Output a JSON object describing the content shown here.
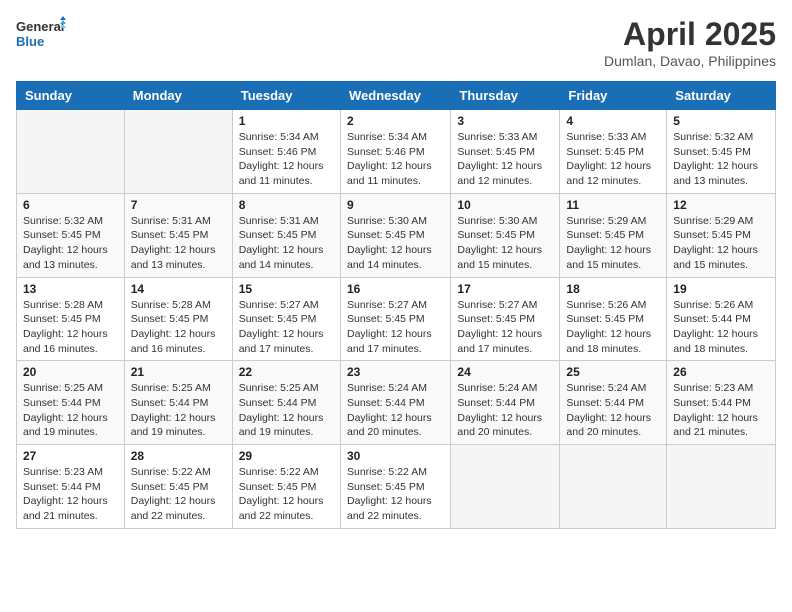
{
  "header": {
    "logo_line1": "General",
    "logo_line2": "Blue",
    "main_title": "April 2025",
    "subtitle": "Dumlan, Davao, Philippines"
  },
  "calendar": {
    "days_of_week": [
      "Sunday",
      "Monday",
      "Tuesday",
      "Wednesday",
      "Thursday",
      "Friday",
      "Saturday"
    ],
    "weeks": [
      [
        {
          "day": "",
          "sunrise": "",
          "sunset": "",
          "daylight": ""
        },
        {
          "day": "",
          "sunrise": "",
          "sunset": "",
          "daylight": ""
        },
        {
          "day": "1",
          "sunrise": "Sunrise: 5:34 AM",
          "sunset": "Sunset: 5:46 PM",
          "daylight": "Daylight: 12 hours and 11 minutes."
        },
        {
          "day": "2",
          "sunrise": "Sunrise: 5:34 AM",
          "sunset": "Sunset: 5:46 PM",
          "daylight": "Daylight: 12 hours and 11 minutes."
        },
        {
          "day": "3",
          "sunrise": "Sunrise: 5:33 AM",
          "sunset": "Sunset: 5:45 PM",
          "daylight": "Daylight: 12 hours and 12 minutes."
        },
        {
          "day": "4",
          "sunrise": "Sunrise: 5:33 AM",
          "sunset": "Sunset: 5:45 PM",
          "daylight": "Daylight: 12 hours and 12 minutes."
        },
        {
          "day": "5",
          "sunrise": "Sunrise: 5:32 AM",
          "sunset": "Sunset: 5:45 PM",
          "daylight": "Daylight: 12 hours and 13 minutes."
        }
      ],
      [
        {
          "day": "6",
          "sunrise": "Sunrise: 5:32 AM",
          "sunset": "Sunset: 5:45 PM",
          "daylight": "Daylight: 12 hours and 13 minutes."
        },
        {
          "day": "7",
          "sunrise": "Sunrise: 5:31 AM",
          "sunset": "Sunset: 5:45 PM",
          "daylight": "Daylight: 12 hours and 13 minutes."
        },
        {
          "day": "8",
          "sunrise": "Sunrise: 5:31 AM",
          "sunset": "Sunset: 5:45 PM",
          "daylight": "Daylight: 12 hours and 14 minutes."
        },
        {
          "day": "9",
          "sunrise": "Sunrise: 5:30 AM",
          "sunset": "Sunset: 5:45 PM",
          "daylight": "Daylight: 12 hours and 14 minutes."
        },
        {
          "day": "10",
          "sunrise": "Sunrise: 5:30 AM",
          "sunset": "Sunset: 5:45 PM",
          "daylight": "Daylight: 12 hours and 15 minutes."
        },
        {
          "day": "11",
          "sunrise": "Sunrise: 5:29 AM",
          "sunset": "Sunset: 5:45 PM",
          "daylight": "Daylight: 12 hours and 15 minutes."
        },
        {
          "day": "12",
          "sunrise": "Sunrise: 5:29 AM",
          "sunset": "Sunset: 5:45 PM",
          "daylight": "Daylight: 12 hours and 15 minutes."
        }
      ],
      [
        {
          "day": "13",
          "sunrise": "Sunrise: 5:28 AM",
          "sunset": "Sunset: 5:45 PM",
          "daylight": "Daylight: 12 hours and 16 minutes."
        },
        {
          "day": "14",
          "sunrise": "Sunrise: 5:28 AM",
          "sunset": "Sunset: 5:45 PM",
          "daylight": "Daylight: 12 hours and 16 minutes."
        },
        {
          "day": "15",
          "sunrise": "Sunrise: 5:27 AM",
          "sunset": "Sunset: 5:45 PM",
          "daylight": "Daylight: 12 hours and 17 minutes."
        },
        {
          "day": "16",
          "sunrise": "Sunrise: 5:27 AM",
          "sunset": "Sunset: 5:45 PM",
          "daylight": "Daylight: 12 hours and 17 minutes."
        },
        {
          "day": "17",
          "sunrise": "Sunrise: 5:27 AM",
          "sunset": "Sunset: 5:45 PM",
          "daylight": "Daylight: 12 hours and 17 minutes."
        },
        {
          "day": "18",
          "sunrise": "Sunrise: 5:26 AM",
          "sunset": "Sunset: 5:45 PM",
          "daylight": "Daylight: 12 hours and 18 minutes."
        },
        {
          "day": "19",
          "sunrise": "Sunrise: 5:26 AM",
          "sunset": "Sunset: 5:44 PM",
          "daylight": "Daylight: 12 hours and 18 minutes."
        }
      ],
      [
        {
          "day": "20",
          "sunrise": "Sunrise: 5:25 AM",
          "sunset": "Sunset: 5:44 PM",
          "daylight": "Daylight: 12 hours and 19 minutes."
        },
        {
          "day": "21",
          "sunrise": "Sunrise: 5:25 AM",
          "sunset": "Sunset: 5:44 PM",
          "daylight": "Daylight: 12 hours and 19 minutes."
        },
        {
          "day": "22",
          "sunrise": "Sunrise: 5:25 AM",
          "sunset": "Sunset: 5:44 PM",
          "daylight": "Daylight: 12 hours and 19 minutes."
        },
        {
          "day": "23",
          "sunrise": "Sunrise: 5:24 AM",
          "sunset": "Sunset: 5:44 PM",
          "daylight": "Daylight: 12 hours and 20 minutes."
        },
        {
          "day": "24",
          "sunrise": "Sunrise: 5:24 AM",
          "sunset": "Sunset: 5:44 PM",
          "daylight": "Daylight: 12 hours and 20 minutes."
        },
        {
          "day": "25",
          "sunrise": "Sunrise: 5:24 AM",
          "sunset": "Sunset: 5:44 PM",
          "daylight": "Daylight: 12 hours and 20 minutes."
        },
        {
          "day": "26",
          "sunrise": "Sunrise: 5:23 AM",
          "sunset": "Sunset: 5:44 PM",
          "daylight": "Daylight: 12 hours and 21 minutes."
        }
      ],
      [
        {
          "day": "27",
          "sunrise": "Sunrise: 5:23 AM",
          "sunset": "Sunset: 5:44 PM",
          "daylight": "Daylight: 12 hours and 21 minutes."
        },
        {
          "day": "28",
          "sunrise": "Sunrise: 5:22 AM",
          "sunset": "Sunset: 5:45 PM",
          "daylight": "Daylight: 12 hours and 22 minutes."
        },
        {
          "day": "29",
          "sunrise": "Sunrise: 5:22 AM",
          "sunset": "Sunset: 5:45 PM",
          "daylight": "Daylight: 12 hours and 22 minutes."
        },
        {
          "day": "30",
          "sunrise": "Sunrise: 5:22 AM",
          "sunset": "Sunset: 5:45 PM",
          "daylight": "Daylight: 12 hours and 22 minutes."
        },
        {
          "day": "",
          "sunrise": "",
          "sunset": "",
          "daylight": ""
        },
        {
          "day": "",
          "sunrise": "",
          "sunset": "",
          "daylight": ""
        },
        {
          "day": "",
          "sunrise": "",
          "sunset": "",
          "daylight": ""
        }
      ]
    ]
  }
}
